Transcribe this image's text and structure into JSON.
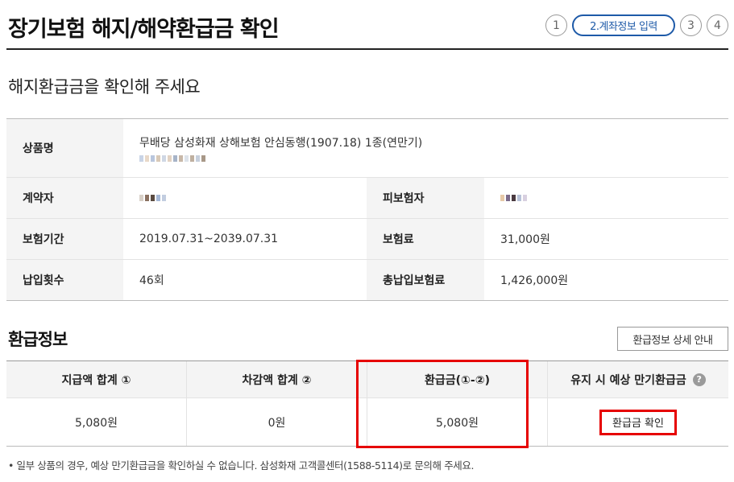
{
  "header": {
    "title": "장기보험 해지/해약환급금 확인",
    "steps": [
      "1",
      "2.계좌정보 입력",
      "3",
      "4"
    ]
  },
  "subtitle": "해지환급금을 확인해 주세요",
  "contract": {
    "product_label": "상품명",
    "product_name": "무배당 삼성화재 상해보험 안심동행(1907.18) 1종(연만기)",
    "contractor_label": "계약자",
    "insured_label": "피보험자",
    "period_label": "보험기간",
    "period_value": "2019.07.31~2039.07.31",
    "premium_label": "보험료",
    "premium_value": "31,000원",
    "count_label": "납입횟수",
    "count_value": "46회",
    "total_label": "총납입보험료",
    "total_value": "1,426,000원"
  },
  "refund": {
    "section_title": "환급정보",
    "detail_button": "환급정보 상세 안내",
    "headers": [
      "지급액 합계 ①",
      "차감액 합계 ②",
      "환급금(①-②)",
      "유지 시 예상 만기환급금"
    ],
    "values": [
      "5,080원",
      "0원",
      "5,080원"
    ],
    "help_icon": "?",
    "confirm_button": "환급금 확인"
  },
  "note": "• 일부 상품의 경우, 예상 만기환급금을 확인하실 수 없습니다. 삼성화재 고객콜센터(1588-5114)로 문의해 주세요.",
  "colors": {
    "accent": "#1e5aa8",
    "highlight": "#e60000",
    "label_bg": "#f4f4f4"
  }
}
